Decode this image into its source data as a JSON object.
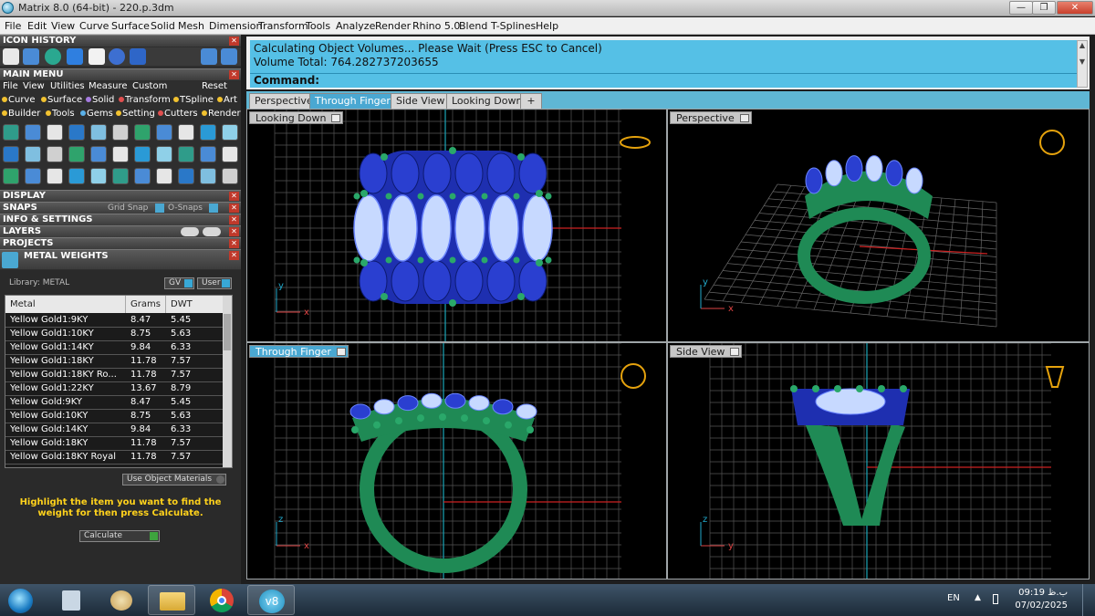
{
  "window": {
    "title": "Matrix 8.0 (64-bit) - 220.p.3dm",
    "controls": [
      "—",
      "❐",
      "✕"
    ]
  },
  "menu": [
    "File",
    "Edit",
    "View",
    "Curve",
    "Surface",
    "Solid",
    "Mesh",
    "Dimension",
    "Transform",
    "Tools",
    "Analyze",
    "Render",
    "Rhino 5.0",
    "Blend",
    "T-Splines",
    "Help"
  ],
  "left": {
    "icon_history": "ICON HISTORY",
    "main_menu": "MAIN MENU",
    "main_menu_items": [
      "File",
      "View",
      "Utilities",
      "Measure",
      "Custom"
    ],
    "reset": "Reset",
    "row1": [
      "Curve",
      "Surface",
      "Solid",
      "Transform",
      "TSpline",
      "Art"
    ],
    "row2": [
      "Builder",
      "Tools",
      "Gems",
      "Setting",
      "Cutters",
      "Render"
    ],
    "display": "DISPLAY",
    "snaps": "SNAPS",
    "grid_snap": "Grid Snap",
    "o_snaps": "O-Snaps",
    "info": "INFO & SETTINGS",
    "layers": "LAYERS",
    "projects": "PROJECTS",
    "metal_weights": "METAL WEIGHTS",
    "library": "Library: METAL",
    "gv": "GV",
    "user": "User",
    "columns": [
      "Metal",
      "Grams",
      "DWT"
    ],
    "rows": [
      [
        "Yellow Gold1:9KY",
        "8.47",
        "5.45"
      ],
      [
        "Yellow Gold1:10KY",
        "8.75",
        "5.63"
      ],
      [
        "Yellow Gold1:14KY",
        "9.84",
        "6.33"
      ],
      [
        "Yellow Gold1:18KY",
        "11.78",
        "7.57"
      ],
      [
        "Yellow Gold1:18KY Ro...",
        "11.78",
        "7.57"
      ],
      [
        "Yellow Gold1:22KY",
        "13.67",
        "8.79"
      ],
      [
        "Yellow Gold:9KY",
        "8.47",
        "5.45"
      ],
      [
        "Yellow Gold:10KY",
        "8.75",
        "5.63"
      ],
      [
        "Yellow Gold:14KY",
        "9.84",
        "6.33"
      ],
      [
        "Yellow Gold:18KY",
        "11.78",
        "7.57"
      ],
      [
        "Yellow Gold:18KY Royal",
        "11.78",
        "7.57"
      ]
    ],
    "use_object_materials": "Use Object Materials",
    "highlight": "Highlight the item you want to find the weight for then press Calculate.",
    "calculate": "Calculate"
  },
  "command": {
    "line1": "Calculating Object Volumes... Please Wait (Press ESC to Cancel)",
    "line2": "Volume Total: 764.282737203655",
    "prompt": "Command:"
  },
  "tabs": [
    "Perspective",
    "Through Finger",
    "Side View",
    "Looking Down",
    "+"
  ],
  "viewports": {
    "tl": "Looking Down",
    "tr": "Perspective",
    "bl": "Through Finger",
    "br": "Side View"
  },
  "axes": {
    "x": "x",
    "y": "y",
    "z": "z"
  },
  "tray": {
    "lang": "EN",
    "time": "09:19",
    "ampm": "ب.ظ",
    "date": "07/02/2025"
  },
  "colors": {
    "accent": "#55c0e6",
    "gem": "#2a3fd0",
    "metal": "#1f8a55"
  }
}
